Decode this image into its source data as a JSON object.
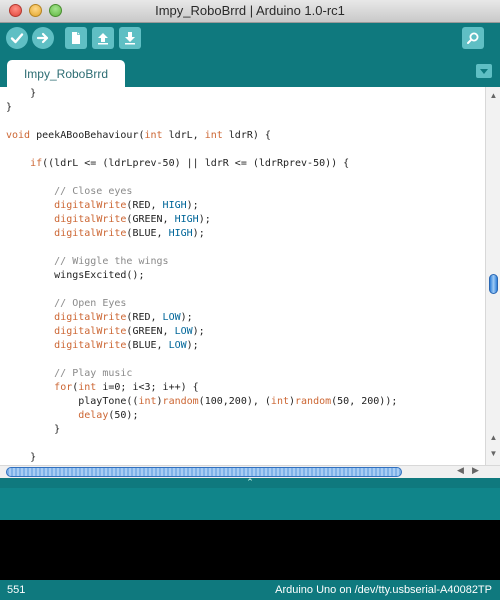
{
  "window": {
    "title": "Impy_RoboBrrd | Arduino 1.0-rc1"
  },
  "toolbar": {
    "buttons": [
      {
        "name": "verify",
        "icon": "checkmark-icon"
      },
      {
        "name": "upload",
        "icon": "arrow-right-icon"
      },
      {
        "name": "new",
        "icon": "new-file-icon"
      },
      {
        "name": "open",
        "icon": "arrow-up-icon"
      },
      {
        "name": "save",
        "icon": "arrow-down-icon"
      },
      {
        "name": "serial-monitor",
        "icon": "magnifier-icon"
      }
    ]
  },
  "tabs": [
    {
      "label": "Impy_RoboBrrd",
      "active": true
    }
  ],
  "code_lines": [
    "    }",
    "}",
    "",
    "void peekABooBehaviour(int ldrL, int ldrR) {",
    "",
    "    if((ldrL <= (ldrLprev-50) || ldrR <= (ldrRprev-50)) {",
    "",
    "        // Close eyes",
    "        digitalWrite(RED, HIGH);",
    "        digitalWrite(GREEN, HIGH);",
    "        digitalWrite(BLUE, HIGH);",
    "",
    "        // Wiggle the wings",
    "        wingsExcited();",
    "",
    "        // Open Eyes",
    "        digitalWrite(RED, LOW);",
    "        digitalWrite(GREEN, LOW);",
    "        digitalWrite(BLUE, LOW);",
    "",
    "        // Play music",
    "        for(int i=0; i<3; i++) {",
    "            playTone((int)random(100,200), (int)random(50, 200));",
    "            delay(50);",
    "        }",
    "",
    "    }"
  ],
  "status": {
    "line": "551",
    "board": "Arduino Uno on /dev/tty.usbserial-A40082TP"
  },
  "colors": {
    "teal": "#0f797e",
    "button": "#5fbfc4",
    "keyword": "#cc6633",
    "constant": "#006699",
    "comment": "#8a8a8a"
  }
}
